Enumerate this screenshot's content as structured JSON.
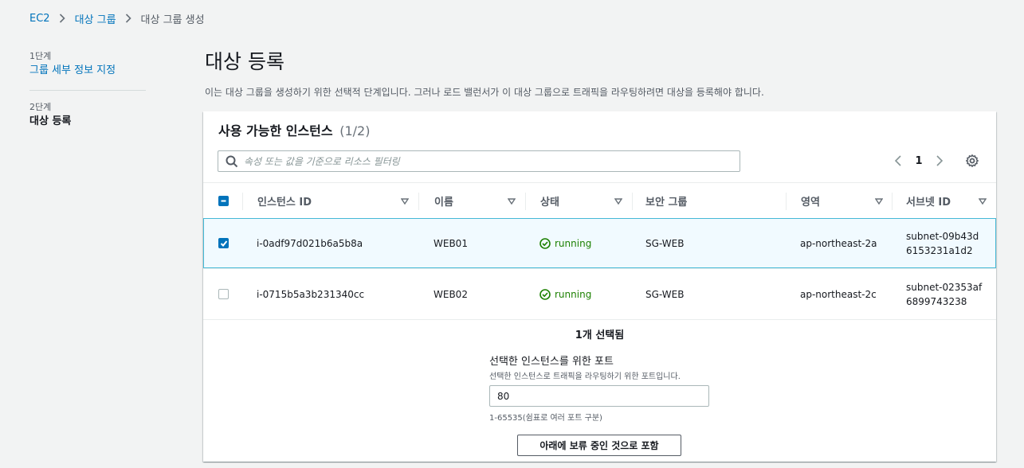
{
  "breadcrumb": {
    "items": [
      {
        "label": "EC2",
        "link": true
      },
      {
        "label": "대상 그룹",
        "link": true
      },
      {
        "label": "대상 그룹 생성",
        "link": false
      }
    ]
  },
  "steps": [
    {
      "step": "1단계",
      "name": "그룹 세부 정보 지정",
      "current": false
    },
    {
      "step": "2단계",
      "name": "대상 등록",
      "current": true
    }
  ],
  "page": {
    "title": "대상 등록",
    "description": "이는 대상 그룹을 생성하기 위한 선택적 단계입니다. 그러나 로드 밸런서가 이 대상 그룹으로 트래픽을 라우팅하려면 대상을 등록해야 합니다."
  },
  "instances": {
    "title": "사용 가능한 인스턴스",
    "count": "(1/2)",
    "filter_placeholder": "속성 또는 값을 기준으로 리소스 필터링",
    "page_number": "1",
    "columns": [
      "인스턴스 ID",
      "이름",
      "상태",
      "보안 그룹",
      "영역",
      "서브넷 ID"
    ],
    "rows": [
      {
        "selected": true,
        "id": "i-0adf97d021b6a5b8a",
        "name": "WEB01",
        "state": "running",
        "sg": "SG-WEB",
        "zone": "ap-northeast-2a",
        "subnet": "subnet-09b43d6153231a1d2"
      },
      {
        "selected": false,
        "id": "i-0715b5a3b231340cc",
        "name": "WEB02",
        "state": "running",
        "sg": "SG-WEB",
        "zone": "ap-northeast-2c",
        "subnet": "subnet-02353af6899743238"
      }
    ],
    "selected_count": "1개 선택됨"
  },
  "port": {
    "label": "선택한 인스턴스를 위한 포트",
    "description": "선택한 인스턴스로 트래픽을 라우팅하기 위한 포트입니다.",
    "value": "80",
    "hint": "1-65535(쉼표로 여러 포트 구분)",
    "include_button": "아래에 보류 중인 것으로 포함"
  },
  "colors": {
    "link": "#0073bb",
    "running": "#1d8102",
    "selected_row_bg": "#f1faff",
    "selected_row_border": "#44b9d6"
  }
}
